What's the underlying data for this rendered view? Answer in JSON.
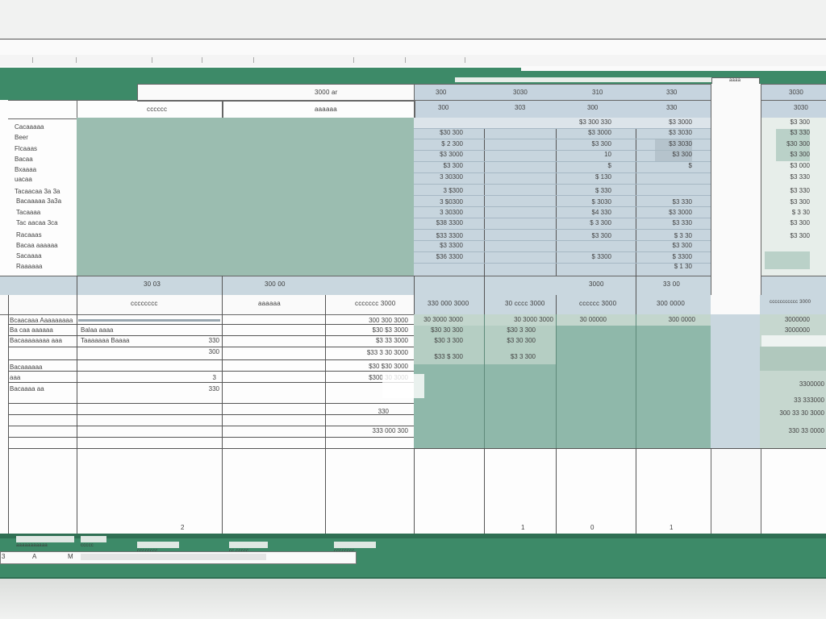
{
  "colors": {
    "frame_green": "#3d8a68",
    "panel_green": "#9bbdb0",
    "panel_blue": "#c6d4df",
    "teal_fill": "#8fb8aa",
    "highlight": "#c9d9d3"
  },
  "menu": {
    "items": [
      "",
      "",
      "",
      "",
      "",
      "",
      "",
      "",
      ""
    ]
  },
  "header": {
    "top_label": "3000 ar",
    "col_years_top": [
      "300",
      "3030",
      "310",
      "330",
      "300"
    ],
    "col_year_right": "3030",
    "block1_label": "cccccc",
    "block2_label": "aaaaaa",
    "col_sub": [
      "300",
      "303",
      "300",
      "330",
      "300"
    ],
    "col_sub_right": "3030"
  },
  "row_labels": [
    "Cacaaaaa",
    "Beer",
    "Flcaaas",
    "Bacaa",
    "Bxaaaa",
    "uacaa",
    "Tacaacaa 3a 3a",
    "Bacaaaaa 3a3a",
    "Tacaaaa",
    "Tac aacaa 3ca",
    "Racaaas",
    "Bacaa aaaaaa",
    "Sacaaaa",
    "Raaaaaa"
  ],
  "data_cols": {
    "c1": [
      "$30 300",
      "$ 2 300",
      "$3 3000",
      "$3 300",
      "3 30300",
      "3 $300",
      "3 $0300",
      "3 30300",
      "$38 3300",
      "$33 3300",
      "$3 3300",
      "$36 3300"
    ],
    "c3": [
      "$3 300 330",
      "$3 3000",
      "$3 300",
      "10",
      "$",
      "$ 130",
      "$ 330",
      "$ 3030",
      "$4 330",
      "$ 3 300",
      "$3 300",
      "$ 3300"
    ],
    "c4": [
      "$3 3000",
      "$3 3030",
      "$3 3030",
      "$3 300",
      "$",
      "$3 330",
      "$3 3000",
      "$3 330",
      "$ 3 30",
      "$3 300",
      "$ 3300",
      "$ 1 30"
    ],
    "c6": [
      "$3 300",
      "$3 330",
      "$30 300",
      "$3 300",
      "$3 000",
      "$3 330",
      "$3 330",
      "$3 300",
      "$ 3 30",
      "$3 300",
      "$3 300"
    ]
  },
  "totals": {
    "t1": "30 03",
    "t2": "300 00",
    "t3": "3000",
    "t4": "33 00"
  },
  "lower": {
    "head1": "cccccccc",
    "head2": "aaaaaa",
    "head3": "ccccccc 3000",
    "head4": "330 000 3000",
    "head5": "30 cccc 3000",
    "head6": "cccccc 3000",
    "head_right": "ccccccccccc 3000",
    "rows_left": [
      "Bcaacaaa Aaaaaaaaa",
      "Ba caa aaaaaa",
      "Bacaaaaaaaa aaa",
      "Bacaaaaaa",
      "aaa",
      "Bacaaaa aa"
    ],
    "rows_mid": [
      "Balaa aaaa",
      "Taaaaaaa Baaaa",
      "",
      "",
      "",
      ""
    ],
    "rows_mid_val": [
      "",
      "330",
      "300",
      "",
      "3",
      "330"
    ],
    "rows_c3": [
      "300 300 3000",
      "$30 $3 3000",
      "$3 33 3000",
      "$33 3 30 3000",
      "$30 $30 3000",
      "$300 30 3000"
    ],
    "rows_c4": [
      "30 3000 3000",
      "$30 30 300",
      "$30 3 300",
      "$33 $ 300"
    ],
    "rows_c5": [
      "30 3000 3000",
      "$30 3 300",
      "$3 30 300",
      "$3 3 300"
    ],
    "rows_c6": [
      "30 00000"
    ],
    "rows_c7": [
      "300 0000"
    ],
    "rows_right": [
      "3000000",
      "3000000",
      "",
      "",
      "3300000",
      "33 333000",
      "300 33 30 3000",
      "330 33 0000"
    ],
    "c3_extra": [
      "330",
      "333 000 300"
    ]
  },
  "footer": {
    "col_nums": [
      "2",
      "1",
      "0",
      "1"
    ],
    "tab_labels": [
      "aaaaaaaaaaa",
      "ccccc",
      "cccccccc",
      "cc ccccc",
      "cccccccc"
    ],
    "status_items": [
      "3",
      "A",
      "M"
    ]
  }
}
